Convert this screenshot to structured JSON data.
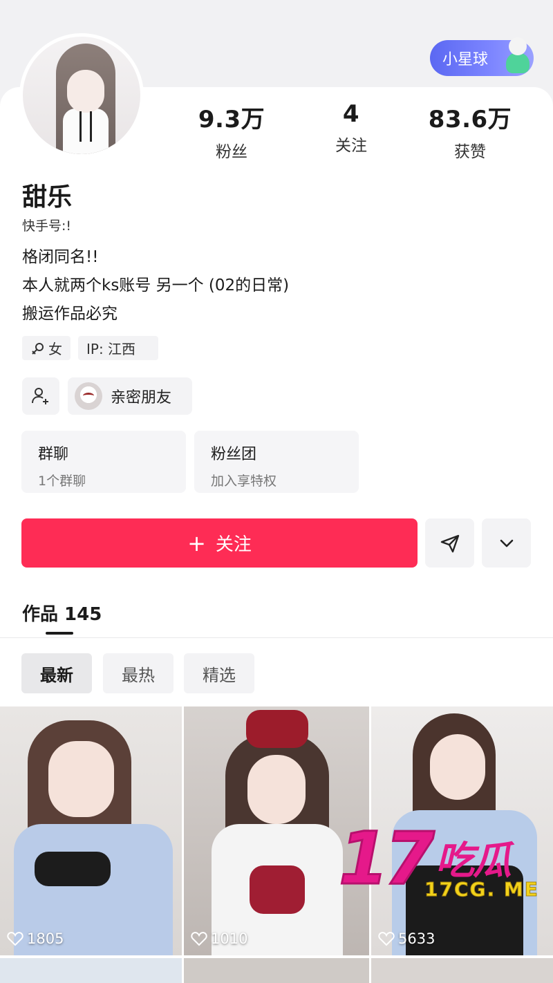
{
  "header": {
    "planet_button_label": "小星球"
  },
  "stats": [
    {
      "value": "9.3万",
      "label": "粉丝"
    },
    {
      "value": "4",
      "label": "关注"
    },
    {
      "value": "83.6万",
      "label": "获赞"
    }
  ],
  "profile": {
    "name": "甜乐",
    "ks_id": "快手号:!",
    "bio_lines": [
      "格闭同名!!",
      "本人就两个ks账号 另一个 (02的日常)",
      "搬运作品必究"
    ],
    "gender_tag": "女",
    "ip_tag": "IP: 江西",
    "close_friends_label": "亲密朋友"
  },
  "cards": [
    {
      "title": "群聊",
      "subtitle": "1个群聊"
    },
    {
      "title": "粉丝团",
      "subtitle": "加入享特权"
    }
  ],
  "actions": {
    "follow_label": "关注",
    "follow_plus": "+"
  },
  "works": {
    "tab_label": "作品 145"
  },
  "filters": [
    "最新",
    "最热",
    "精选"
  ],
  "thumbnails": [
    {
      "likes": "1805"
    },
    {
      "likes": "1010"
    },
    {
      "likes": "5633"
    }
  ],
  "watermark": {
    "number": "17",
    "text": "吃瓜",
    "url": "17CG. ME"
  },
  "colors": {
    "accent": "#fe2c55",
    "planet_gradient_start": "#5b68f2",
    "watermark_pink": "#e5198a",
    "watermark_yellow": "#f2d21b"
  }
}
